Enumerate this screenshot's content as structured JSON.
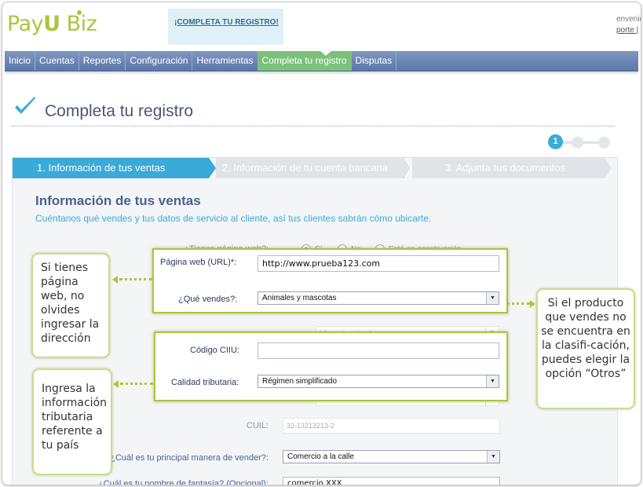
{
  "header": {
    "logo_text_a": "Pay",
    "logo_text_u": "U",
    "logo_text_b": " Biz",
    "banner_link": "¡COMPLETA TU REGISTRO!",
    "right_line1": "envenid",
    "right_line2": "porte |"
  },
  "nav": {
    "items": [
      {
        "label": "Inicio"
      },
      {
        "label": "Cuentas"
      },
      {
        "label": "Reportes"
      },
      {
        "label": "Configuración"
      },
      {
        "label": "Herramientas"
      },
      {
        "label": "Completa tu registro",
        "active": true
      },
      {
        "label": "Disputas"
      }
    ]
  },
  "page": {
    "title": "Completa tu registro",
    "progress_step": "1"
  },
  "steps": [
    {
      "label": "1. Información de tus ventas"
    },
    {
      "label": "2. Información de tu cuenta bancaria"
    },
    {
      "label": "3. Adjunta tus documentos"
    }
  ],
  "section": {
    "title": "Información de tus ventas",
    "subtitle": "Cuéntanos qué vendes y tus datos de servicio al cliente, así tus clientes sabrán cómo ubicarte."
  },
  "form": {
    "has_web_label": "¿Tienes página web?:",
    "radio_yes": "Sí",
    "radio_no": "No",
    "radio_building": "Está en construcción",
    "web_url_label": "Página web (URL)*:",
    "web_url_value": "http://www.prueba123.com",
    "what_sell_label": "¿Qué vendes?:",
    "what_sell_value": "Animales y mascotas",
    "ghost_select_value": "Libros de animales",
    "ciiu_label": "Código CIIU:",
    "ciiu_value": "",
    "tax_label": "Calidad tributaria:",
    "tax_value": "Régimen simplificado",
    "cuil_label": "CUIL:",
    "cuil_value": "32-13213213-2",
    "sell_method_label": "¿Cuál es tu principal manera de vender?:",
    "sell_method_value": "Comercio a la calle",
    "fantasy_label": "¿Cuál es tu nombre de fantasía? (Opcional):",
    "fantasy_value": "comercio XXX"
  },
  "callouts": {
    "left_top": "Si tienes página web, no olvides ingresar la dirección",
    "left_bottom": "Ingresa la información tributaria referente a  tu país",
    "right": "Si el producto que vendes no se encuentra en la clasifi-cación, puedes elegir la opción “Otros”"
  },
  "colors": {
    "nav_bg": "#6a84b4",
    "nav_active": "#7cc17a",
    "step_active": "#3aaad8",
    "accent_green": "#a9c63c",
    "title_blue": "#4a6290"
  }
}
